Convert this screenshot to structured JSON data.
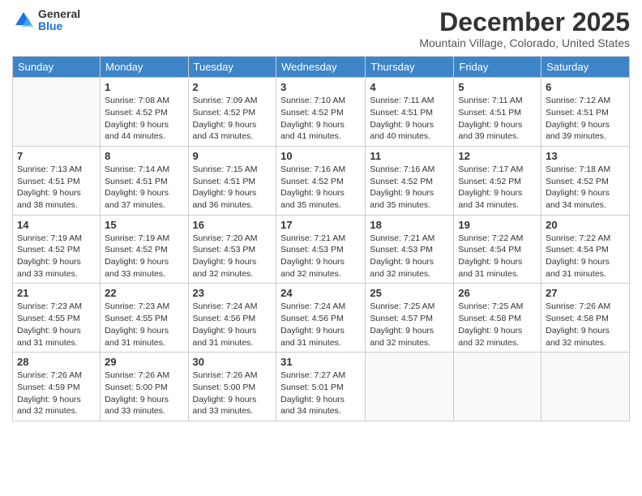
{
  "logo": {
    "general": "General",
    "blue": "Blue"
  },
  "title": "December 2025",
  "location": "Mountain Village, Colorado, United States",
  "days_of_week": [
    "Sunday",
    "Monday",
    "Tuesday",
    "Wednesday",
    "Thursday",
    "Friday",
    "Saturday"
  ],
  "weeks": [
    [
      {
        "day": "",
        "sunrise": "",
        "sunset": "",
        "daylight": ""
      },
      {
        "day": "1",
        "sunrise": "Sunrise: 7:08 AM",
        "sunset": "Sunset: 4:52 PM",
        "daylight": "Daylight: 9 hours and 44 minutes."
      },
      {
        "day": "2",
        "sunrise": "Sunrise: 7:09 AM",
        "sunset": "Sunset: 4:52 PM",
        "daylight": "Daylight: 9 hours and 43 minutes."
      },
      {
        "day": "3",
        "sunrise": "Sunrise: 7:10 AM",
        "sunset": "Sunset: 4:52 PM",
        "daylight": "Daylight: 9 hours and 41 minutes."
      },
      {
        "day": "4",
        "sunrise": "Sunrise: 7:11 AM",
        "sunset": "Sunset: 4:51 PM",
        "daylight": "Daylight: 9 hours and 40 minutes."
      },
      {
        "day": "5",
        "sunrise": "Sunrise: 7:11 AM",
        "sunset": "Sunset: 4:51 PM",
        "daylight": "Daylight: 9 hours and 39 minutes."
      },
      {
        "day": "6",
        "sunrise": "Sunrise: 7:12 AM",
        "sunset": "Sunset: 4:51 PM",
        "daylight": "Daylight: 9 hours and 39 minutes."
      }
    ],
    [
      {
        "day": "7",
        "sunrise": "Sunrise: 7:13 AM",
        "sunset": "Sunset: 4:51 PM",
        "daylight": "Daylight: 9 hours and 38 minutes."
      },
      {
        "day": "8",
        "sunrise": "Sunrise: 7:14 AM",
        "sunset": "Sunset: 4:51 PM",
        "daylight": "Daylight: 9 hours and 37 minutes."
      },
      {
        "day": "9",
        "sunrise": "Sunrise: 7:15 AM",
        "sunset": "Sunset: 4:51 PM",
        "daylight": "Daylight: 9 hours and 36 minutes."
      },
      {
        "day": "10",
        "sunrise": "Sunrise: 7:16 AM",
        "sunset": "Sunset: 4:52 PM",
        "daylight": "Daylight: 9 hours and 35 minutes."
      },
      {
        "day": "11",
        "sunrise": "Sunrise: 7:16 AM",
        "sunset": "Sunset: 4:52 PM",
        "daylight": "Daylight: 9 hours and 35 minutes."
      },
      {
        "day": "12",
        "sunrise": "Sunrise: 7:17 AM",
        "sunset": "Sunset: 4:52 PM",
        "daylight": "Daylight: 9 hours and 34 minutes."
      },
      {
        "day": "13",
        "sunrise": "Sunrise: 7:18 AM",
        "sunset": "Sunset: 4:52 PM",
        "daylight": "Daylight: 9 hours and 34 minutes."
      }
    ],
    [
      {
        "day": "14",
        "sunrise": "Sunrise: 7:19 AM",
        "sunset": "Sunset: 4:52 PM",
        "daylight": "Daylight: 9 hours and 33 minutes."
      },
      {
        "day": "15",
        "sunrise": "Sunrise: 7:19 AM",
        "sunset": "Sunset: 4:52 PM",
        "daylight": "Daylight: 9 hours and 33 minutes."
      },
      {
        "day": "16",
        "sunrise": "Sunrise: 7:20 AM",
        "sunset": "Sunset: 4:53 PM",
        "daylight": "Daylight: 9 hours and 32 minutes."
      },
      {
        "day": "17",
        "sunrise": "Sunrise: 7:21 AM",
        "sunset": "Sunset: 4:53 PM",
        "daylight": "Daylight: 9 hours and 32 minutes."
      },
      {
        "day": "18",
        "sunrise": "Sunrise: 7:21 AM",
        "sunset": "Sunset: 4:53 PM",
        "daylight": "Daylight: 9 hours and 32 minutes."
      },
      {
        "day": "19",
        "sunrise": "Sunrise: 7:22 AM",
        "sunset": "Sunset: 4:54 PM",
        "daylight": "Daylight: 9 hours and 31 minutes."
      },
      {
        "day": "20",
        "sunrise": "Sunrise: 7:22 AM",
        "sunset": "Sunset: 4:54 PM",
        "daylight": "Daylight: 9 hours and 31 minutes."
      }
    ],
    [
      {
        "day": "21",
        "sunrise": "Sunrise: 7:23 AM",
        "sunset": "Sunset: 4:55 PM",
        "daylight": "Daylight: 9 hours and 31 minutes."
      },
      {
        "day": "22",
        "sunrise": "Sunrise: 7:23 AM",
        "sunset": "Sunset: 4:55 PM",
        "daylight": "Daylight: 9 hours and 31 minutes."
      },
      {
        "day": "23",
        "sunrise": "Sunrise: 7:24 AM",
        "sunset": "Sunset: 4:56 PM",
        "daylight": "Daylight: 9 hours and 31 minutes."
      },
      {
        "day": "24",
        "sunrise": "Sunrise: 7:24 AM",
        "sunset": "Sunset: 4:56 PM",
        "daylight": "Daylight: 9 hours and 31 minutes."
      },
      {
        "day": "25",
        "sunrise": "Sunrise: 7:25 AM",
        "sunset": "Sunset: 4:57 PM",
        "daylight": "Daylight: 9 hours and 32 minutes."
      },
      {
        "day": "26",
        "sunrise": "Sunrise: 7:25 AM",
        "sunset": "Sunset: 4:58 PM",
        "daylight": "Daylight: 9 hours and 32 minutes."
      },
      {
        "day": "27",
        "sunrise": "Sunrise: 7:26 AM",
        "sunset": "Sunset: 4:58 PM",
        "daylight": "Daylight: 9 hours and 32 minutes."
      }
    ],
    [
      {
        "day": "28",
        "sunrise": "Sunrise: 7:26 AM",
        "sunset": "Sunset: 4:59 PM",
        "daylight": "Daylight: 9 hours and 32 minutes."
      },
      {
        "day": "29",
        "sunrise": "Sunrise: 7:26 AM",
        "sunset": "Sunset: 5:00 PM",
        "daylight": "Daylight: 9 hours and 33 minutes."
      },
      {
        "day": "30",
        "sunrise": "Sunrise: 7:26 AM",
        "sunset": "Sunset: 5:00 PM",
        "daylight": "Daylight: 9 hours and 33 minutes."
      },
      {
        "day": "31",
        "sunrise": "Sunrise: 7:27 AM",
        "sunset": "Sunset: 5:01 PM",
        "daylight": "Daylight: 9 hours and 34 minutes."
      },
      {
        "day": "",
        "sunrise": "",
        "sunset": "",
        "daylight": ""
      },
      {
        "day": "",
        "sunrise": "",
        "sunset": "",
        "daylight": ""
      },
      {
        "day": "",
        "sunrise": "",
        "sunset": "",
        "daylight": ""
      }
    ]
  ]
}
